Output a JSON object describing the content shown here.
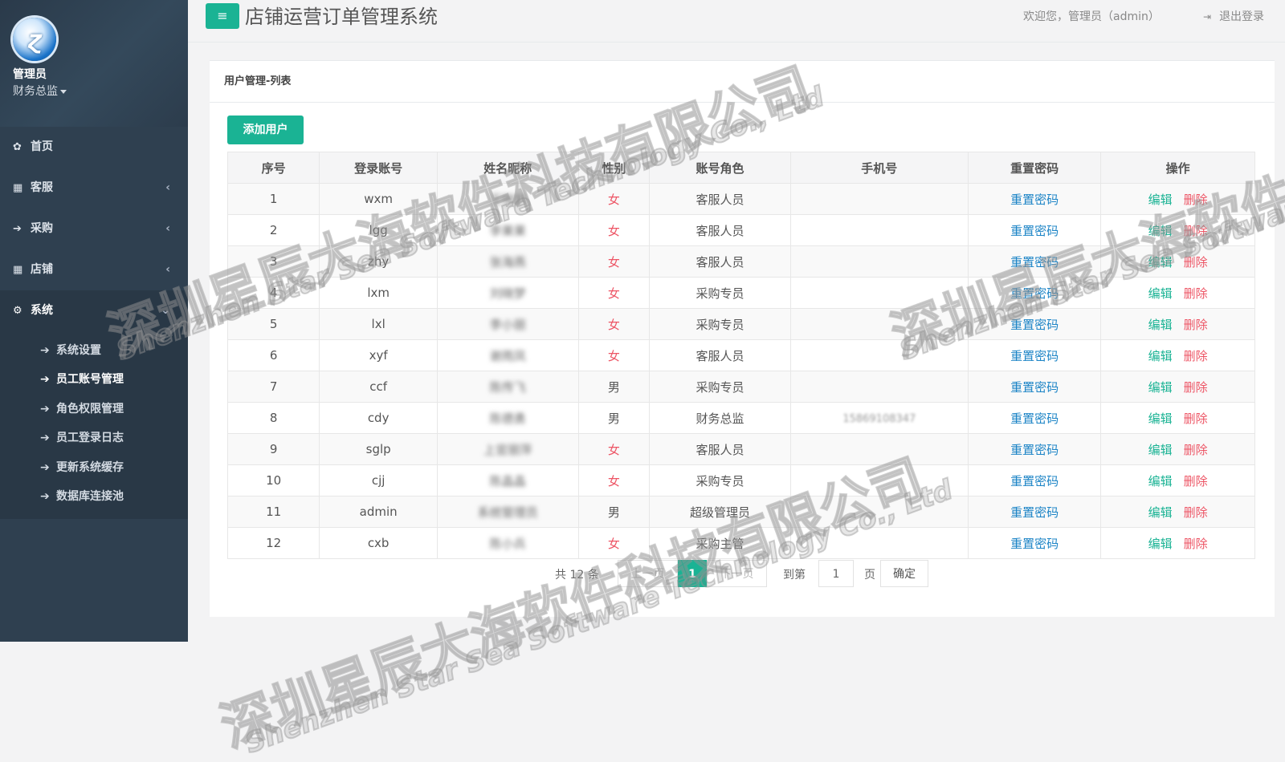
{
  "sidebar": {
    "user_name": "管理员",
    "user_role": "财务总监",
    "nav": [
      {
        "label": "首页",
        "icon": "dashboard-icon"
      },
      {
        "label": "客服",
        "icon": "grid-icon"
      },
      {
        "label": "采购",
        "icon": "arrow-right-icon"
      },
      {
        "label": "店铺",
        "icon": "grid-icon"
      },
      {
        "label": "系统",
        "icon": "gear-icon"
      }
    ],
    "subnav": [
      {
        "label": "系统设置"
      },
      {
        "label": "员工账号管理"
      },
      {
        "label": "角色权限管理"
      },
      {
        "label": "员工登录日志"
      },
      {
        "label": "更新系统缓存"
      },
      {
        "label": "数据库连接池"
      }
    ]
  },
  "header": {
    "title": "店铺运营订单管理系统",
    "welcome": "欢迎您，管理员（admin）",
    "logout": "退出登录"
  },
  "panel": {
    "title": "用户管理-列表",
    "add_button": "添加用户"
  },
  "table": {
    "columns": [
      "序号",
      "登录账号",
      "姓名昵称",
      "性别",
      "账号角色",
      "手机号",
      "重置密码",
      "操作"
    ],
    "rows": [
      {
        "no": "1",
        "account": "wxm",
        "name": "王晓梦",
        "gender": "女",
        "role": "客服人员",
        "phone": "",
        "reset": "重置密码",
        "edit": "编辑",
        "del": "删除"
      },
      {
        "no": "2",
        "account": "lgg",
        "name": "李果果",
        "gender": "女",
        "role": "客服人员",
        "phone": "",
        "reset": "重置密码",
        "edit": "编辑",
        "del": "删除"
      },
      {
        "no": "3",
        "account": "zhy",
        "name": "张海燕",
        "gender": "女",
        "role": "客服人员",
        "phone": "",
        "reset": "重置密码",
        "edit": "编辑",
        "del": "删除"
      },
      {
        "no": "4",
        "account": "lxm",
        "name": "刘晓梦",
        "gender": "女",
        "role": "采购专员",
        "phone": "",
        "reset": "重置密码",
        "edit": "编辑",
        "del": "删除"
      },
      {
        "no": "5",
        "account": "lxl",
        "name": "李小丽",
        "gender": "女",
        "role": "采购专员",
        "phone": "",
        "reset": "重置密码",
        "edit": "编辑",
        "del": "删除"
      },
      {
        "no": "6",
        "account": "xyf",
        "name": "谢雨凤",
        "gender": "女",
        "role": "客服人员",
        "phone": "",
        "reset": "重置密码",
        "edit": "编辑",
        "del": "删除"
      },
      {
        "no": "7",
        "account": "ccf",
        "name": "陈传飞",
        "gender": "男",
        "role": "采购专员",
        "phone": "",
        "reset": "重置密码",
        "edit": "编辑",
        "del": "删除"
      },
      {
        "no": "8",
        "account": "cdy",
        "name": "陈德勇",
        "gender": "男",
        "role": "财务总监",
        "phone": "15869108347",
        "reset": "重置密码",
        "edit": "编辑",
        "del": "删除"
      },
      {
        "no": "9",
        "account": "sglp",
        "name": "上官丽萍",
        "gender": "女",
        "role": "客服人员",
        "phone": "",
        "reset": "重置密码",
        "edit": "编辑",
        "del": "删除"
      },
      {
        "no": "10",
        "account": "cjj",
        "name": "陈晶晶",
        "gender": "女",
        "role": "采购专员",
        "phone": "",
        "reset": "重置密码",
        "edit": "编辑",
        "del": "删除"
      },
      {
        "no": "11",
        "account": "admin",
        "name": "系统管理员",
        "gender": "男",
        "role": "超级管理员",
        "phone": "",
        "reset": "重置密码",
        "edit": "编辑",
        "del": "删除"
      },
      {
        "no": "12",
        "account": "cxb",
        "name": "陈小兵",
        "gender": "女",
        "role": "采购主管",
        "phone": "",
        "reset": "重置密码",
        "edit": "编辑",
        "del": "删除"
      }
    ]
  },
  "pagination": {
    "total": "共 12 条",
    "prev": "上一页",
    "current": "1",
    "next": "下一页",
    "goto_label": "到第",
    "goto_value": "1",
    "page_label": "页",
    "confirm": "确定"
  },
  "watermark": {
    "cn": "深圳星辰大海软件科技有限公司",
    "en": "Shenzhen Star Sea Software Technology Co., Ltd"
  },
  "colors": {
    "sidebar": "#2f4050",
    "accent": "#1ab394",
    "link": "#1c84c6",
    "danger": "#ed5565"
  }
}
